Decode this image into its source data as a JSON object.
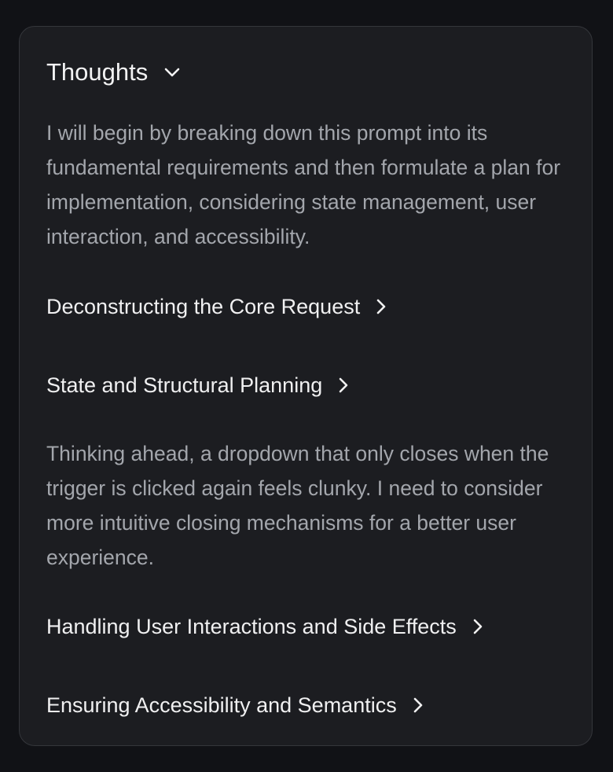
{
  "thoughts": {
    "title": "Thoughts",
    "toggle_icon": "chevron-down-icon",
    "intro": "I will begin by breaking down this prompt into its fundamental requirements and then formulate a plan for implementation, considering state management, user interaction, and accessibility.",
    "sections": [
      {
        "label": "Deconstructing the Core Request",
        "icon": "chevron-right-icon"
      },
      {
        "label": "State and Structural Planning",
        "icon": "chevron-right-icon"
      },
      {
        "label": "Handling User Interactions and Side Effects",
        "icon": "chevron-right-icon"
      },
      {
        "label": "Ensuring Accessibility and Semantics",
        "icon": "chevron-right-icon"
      }
    ],
    "note": "Thinking ahead, a dropdown that only closes when the trigger is clicked again feels clunky. I need to consider more intuitive closing mechanisms for a better user experience."
  }
}
